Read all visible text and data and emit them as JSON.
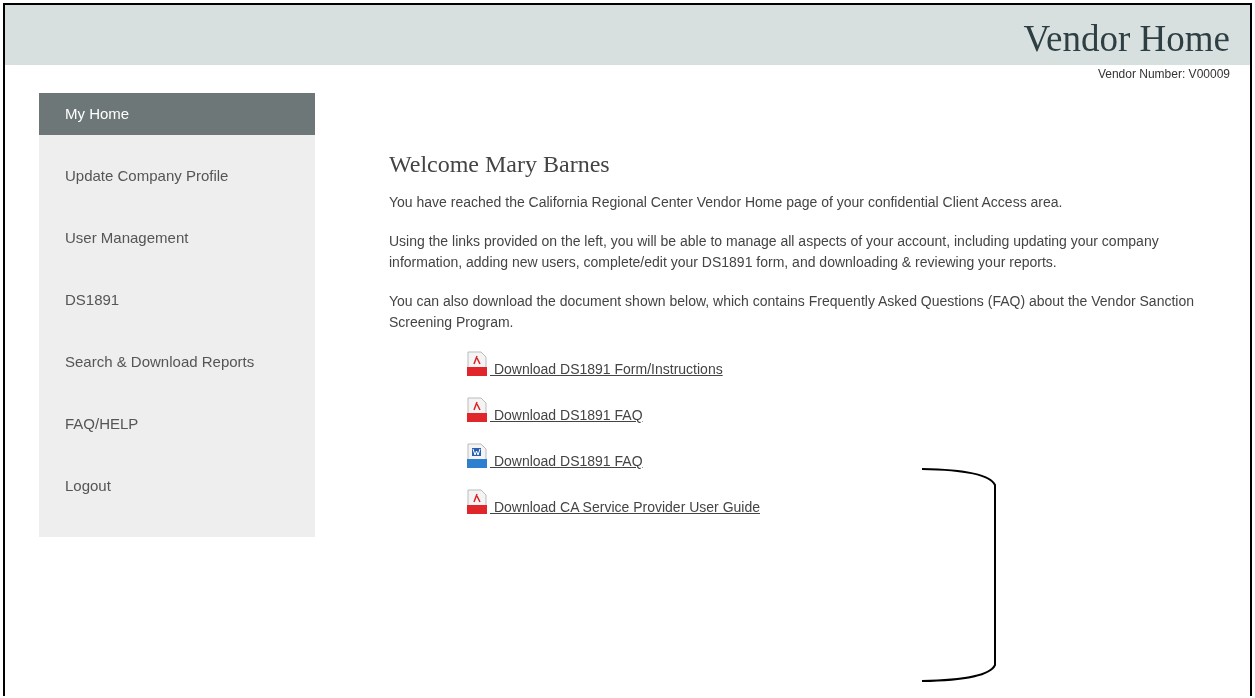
{
  "header": {
    "title": "Vendor Home",
    "vendor_number": "Vendor Number: V00009"
  },
  "sidebar": {
    "items": [
      {
        "label": "My Home",
        "selected": true
      },
      {
        "label": "Update Company Profile",
        "selected": false
      },
      {
        "label": "User Management",
        "selected": false
      },
      {
        "label": "DS1891",
        "selected": false
      },
      {
        "label": "Search & Download Reports",
        "selected": false
      },
      {
        "label": "FAQ/HELP",
        "selected": false
      },
      {
        "label": "Logout",
        "selected": false
      }
    ]
  },
  "content": {
    "heading": "Welcome Mary Barnes",
    "paragraphs": [
      "You have reached the California Regional Center Vendor Home page of your confidential Client Access area.",
      "Using the links provided on the left, you will be able to manage all aspects of your account, including updating your company information, adding new users, complete/edit your DS1891 form, and downloading & reviewing your reports.",
      "You can also download the document shown below, which contains Frequently Asked Questions (FAQ) about the Vendor Sanction Screening Program."
    ],
    "downloads": [
      {
        "kind": "pdf",
        "label": " Download DS1891 Form/Instructions"
      },
      {
        "kind": "pdf",
        "label": " Download DS1891 FAQ"
      },
      {
        "kind": "doc",
        "label": " Download DS1891 FAQ"
      },
      {
        "kind": "pdf",
        "label": " Download CA Service Provider User Guide"
      }
    ]
  }
}
